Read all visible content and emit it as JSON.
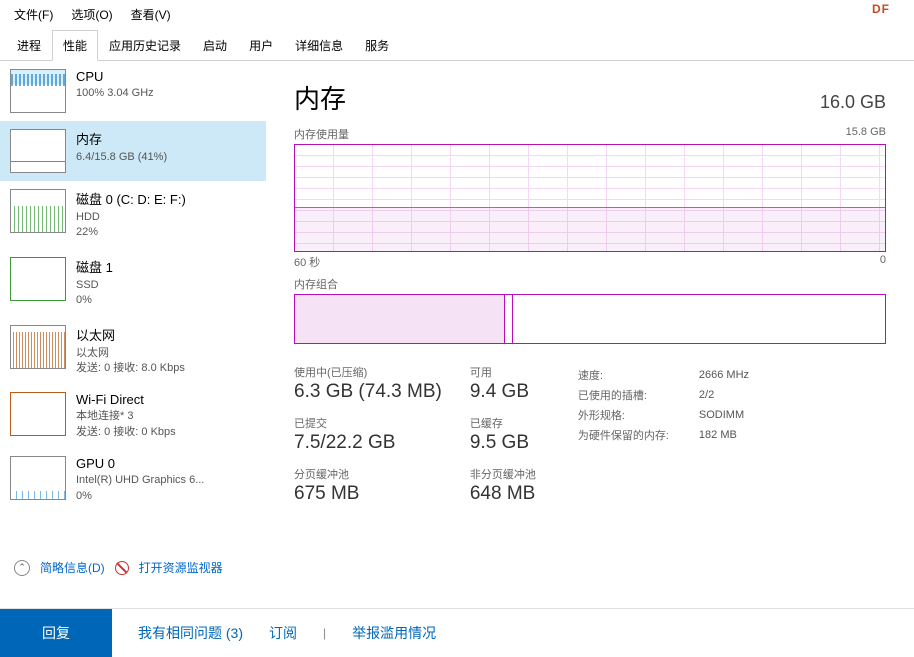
{
  "menu": {
    "file": "文件(F)",
    "options": "选项(O)",
    "view": "查看(V)"
  },
  "watermark": "DF",
  "tabs": [
    "进程",
    "性能",
    "应用历史记录",
    "启动",
    "用户",
    "详细信息",
    "服务"
  ],
  "active_tab_index": 1,
  "sidebar": [
    {
      "title": "CPU",
      "line1": "100% 3.04 GHz",
      "line2": "",
      "thumb": "th-cpu"
    },
    {
      "title": "内存",
      "line1": "6.4/15.8 GB (41%)",
      "line2": "",
      "thumb": "th-mem",
      "selected": true
    },
    {
      "title": "磁盘 0 (C: D: E: F:)",
      "line1": "HDD",
      "line2": "22%",
      "thumb": "th-disk0"
    },
    {
      "title": "磁盘 1",
      "line1": "SSD",
      "line2": "0%",
      "thumb": "th-disk1"
    },
    {
      "title": "以太网",
      "line1": "以太网",
      "line2": "发送: 0 接收: 8.0 Kbps",
      "thumb": "th-eth"
    },
    {
      "title": "Wi-Fi Direct",
      "line1": "本地连接* 3",
      "line2": "发送: 0 接收: 0 Kbps",
      "thumb": "th-wifi"
    },
    {
      "title": "GPU 0",
      "line1": "Intel(R) UHD Graphics 6...",
      "line2": "0%",
      "thumb": "th-gpu"
    }
  ],
  "detail": {
    "title": "内存",
    "total": "16.0 GB",
    "usage_label": "内存使用量",
    "usage_max": "15.8 GB",
    "axis_left": "60 秒",
    "axis_right": "0",
    "composition_label": "内存组合",
    "stats": {
      "in_use_label": "使用中(已压缩)",
      "in_use": "6.3 GB (74.3 MB)",
      "available_label": "可用",
      "available": "9.4 GB",
      "committed_label": "已提交",
      "committed": "7.5/22.2 GB",
      "cached_label": "已缓存",
      "cached": "9.5 GB",
      "paged_label": "分页缓冲池",
      "paged": "675 MB",
      "nonpaged_label": "非分页缓冲池",
      "nonpaged": "648 MB"
    },
    "specs": {
      "speed_label": "速度:",
      "speed": "2666 MHz",
      "slots_label": "已使用的插槽:",
      "slots": "2/2",
      "form_label": "外形规格:",
      "form": "SODIMM",
      "reserved_label": "为硬件保留的内存:",
      "reserved": "182 MB"
    }
  },
  "footer": {
    "brief": "简略信息(D)",
    "resmon": "打开资源监视器"
  },
  "bottombar": {
    "reply": "回复",
    "same_issue": "我有相同问题 (3)",
    "subscribe": "订阅",
    "report": "举报滥用情况"
  }
}
